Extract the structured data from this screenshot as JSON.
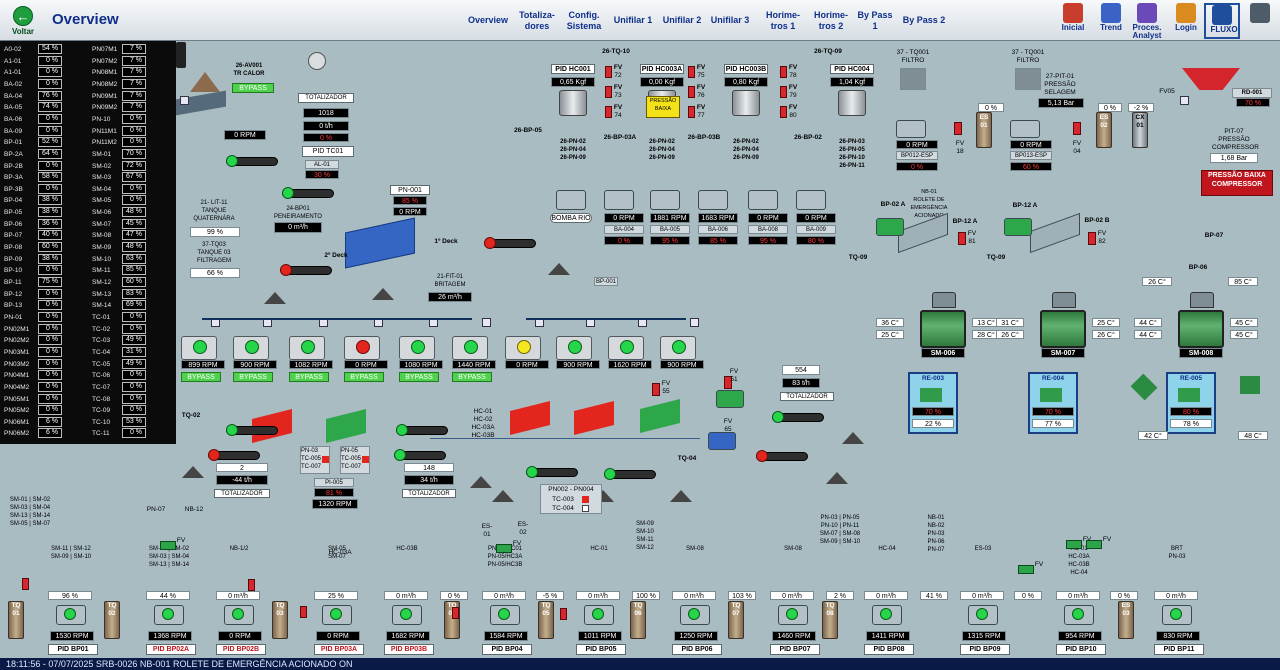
{
  "header": {
    "back_label": "Voltar",
    "title": "Overview",
    "nav": [
      "Overview",
      "Totaliza-\ndores",
      "Config.\nSistema",
      "Unifilar 1",
      "Unifilar 2",
      "Unifilar 3",
      "Horime-\ntros 1",
      "Horime-\ntros 2",
      "By Pass 1",
      "By Pass 2"
    ],
    "tools": [
      "Inicial",
      "Trend",
      "Proces.\nAnalyst",
      "Login",
      "FLUXO",
      ""
    ]
  },
  "left_table": {
    "left": [
      [
        "A0-02",
        "54 %"
      ],
      [
        "A1-01",
        "0 %"
      ],
      [
        "A1-01",
        "0 %"
      ],
      [
        "BA-02",
        "0 %"
      ],
      [
        "BA-04",
        "76 %"
      ],
      [
        "BA-05",
        "74 %"
      ],
      [
        "BA-06",
        "0 %"
      ],
      [
        "BA-09",
        "0 %"
      ],
      [
        "BP-01",
        "52 %"
      ],
      [
        "BP-2A",
        "64 %"
      ],
      [
        "BP-2B",
        "0 %"
      ],
      [
        "BP-3A",
        "58 %"
      ],
      [
        "BP-3B",
        "0 %"
      ],
      [
        "BP-04",
        "38 %"
      ],
      [
        "BP-05",
        "38 %"
      ],
      [
        "BP-06",
        "36 %"
      ],
      [
        "BP-07",
        "40 %"
      ],
      [
        "BP-08",
        "60 %"
      ],
      [
        "BP-09",
        "38 %"
      ],
      [
        "BP-10",
        "0 %"
      ],
      [
        "BP-11",
        "75 %"
      ],
      [
        "BP-12",
        "0 %"
      ],
      [
        "BP-13",
        "0 %"
      ],
      [
        "PN-01",
        "0 %"
      ],
      [
        "PN02M1",
        "0 %"
      ],
      [
        "PN02M2",
        "0 %"
      ],
      [
        "PN03M1",
        "0 %"
      ],
      [
        "PN03M2",
        "0 %"
      ],
      [
        "PN04M1",
        "0 %"
      ],
      [
        "PN04M2",
        "0 %"
      ],
      [
        "PN05M1",
        "0 %"
      ],
      [
        "PN05M2",
        "0 %"
      ],
      [
        "PN06M1",
        "6 %"
      ],
      [
        "PN06M2",
        "6 %"
      ]
    ],
    "right": [
      [
        "PN07M1",
        "7 %"
      ],
      [
        "PN07M2",
        "7 %"
      ],
      [
        "PN08M1",
        "7 %"
      ],
      [
        "PN08M2",
        "7 %"
      ],
      [
        "PN09M1",
        "7 %"
      ],
      [
        "PN09M2",
        "7 %"
      ],
      [
        "PN-10",
        "0 %"
      ],
      [
        "PN11M1",
        "0 %"
      ],
      [
        "PN11M2",
        "0 %"
      ],
      [
        "SM-01",
        "70 %"
      ],
      [
        "SM-02",
        "72 %"
      ],
      [
        "SM-03",
        "67 %"
      ],
      [
        "SM-04",
        "0 %"
      ],
      [
        "SM-05",
        "0 %"
      ],
      [
        "SM-06",
        "48 %"
      ],
      [
        "SM-07",
        "45 %"
      ],
      [
        "SM-08",
        "47 %"
      ],
      [
        "SM-09",
        "48 %"
      ],
      [
        "SM-10",
        "63 %"
      ],
      [
        "SM-11",
        "85 %"
      ],
      [
        "SM-12",
        "60 %"
      ],
      [
        "SM-13",
        "83 %"
      ],
      [
        "SM-14",
        "69 %"
      ],
      [
        "TC-01",
        "0 %"
      ],
      [
        "TC-02",
        "0 %"
      ],
      [
        "TC-03",
        "49 %"
      ],
      [
        "TC-04",
        "31 %"
      ],
      [
        "TC-05",
        "49 %"
      ],
      [
        "TC-06",
        "0 %"
      ],
      [
        "TC-07",
        "0 %"
      ],
      [
        "TC-08",
        "0 %"
      ],
      [
        "TC-09",
        "0 %"
      ],
      [
        "TC-10",
        "53 %"
      ],
      [
        "TC-11",
        "0 %"
      ]
    ]
  },
  "top_area": {
    "av001_label": "26-AV001\nTR CALOR",
    "bypass": "BYPASS",
    "rpm_av": "0 RPM",
    "totalizador_label": "TOTALIZADOR",
    "totalizador_val1": "1018",
    "totalizador_val2": "0 t/h",
    "totalizador_pct": "0 %",
    "pid_tc01": "PID TC01",
    "al01_label": "AL-01",
    "al01_pct": "30 %",
    "bp01_label": "24-BP01\nPENEIRAMENTO",
    "bp01_val": "0 m³/h",
    "pn001_label": "PN-001",
    "pn001_pct": "85 %",
    "pn001_rpm": "0 RPM",
    "deck1": "1º Deck",
    "deck2": "2º Deck",
    "lit11_label": "21- LIT-11\nTANQUE\nQUATERNÁRA",
    "lit11_val": "99 %",
    "tq03_label": "37-TQ03\nTANQUE 03\nFILTRAGEM",
    "tq03_val": "66 %",
    "fit01_label": "21-FIT-01\nBRITAGEM",
    "fit01_val": "26 m³/h",
    "bp001": "BP-001"
  },
  "hc_area": {
    "tq10": "26-TQ-10",
    "tq09": "26-TQ-09",
    "bp05": "26-BP-05",
    "bp03a": "26-BP-03A",
    "bp03b": "26-BP-03B",
    "bp02": "26-BP-02",
    "pressao": "PRESSÃO\nBAIXA",
    "units": [
      {
        "pid": "PID HC001",
        "val": "0,65 Kgf",
        "pns": "26-PN-02\n26-PN-04\n26-PN-09"
      },
      {
        "pid": "PID HC003A",
        "val": "0,00 Kgf",
        "pns": "26-PN-02\n26-PN-04\n26-PN-09"
      },
      {
        "pid": "PID HC003B",
        "val": "0,80 Kgf",
        "pns": "26-PN-02\n26-PN-04\n26-PN-09"
      },
      {
        "pid": "PID HC004",
        "val": "1,04 Kgf",
        "pns": "26-PN-03\n26-PN-05\n26-PN-10\n26-PN-11"
      }
    ],
    "fv_numbers": [
      "72",
      "73",
      "74",
      "75",
      "76",
      "77",
      "78",
      "79",
      "80"
    ],
    "fv": "FV"
  },
  "pumps": {
    "bomba_rio": "BOMBA RIO",
    "items": [
      {
        "rpm": "0 RPM",
        "name": "BA-004",
        "pct": "0 %"
      },
      {
        "rpm": "1881 RPM",
        "name": "BA-005",
        "pct": "95 %"
      },
      {
        "rpm": "1683 RPM",
        "name": "BA-006",
        "pct": "85 %"
      },
      {
        "rpm": "0 RPM",
        "name": "BA-008",
        "pct": "95 %"
      },
      {
        "rpm": "0 RPM",
        "name": "BA-009",
        "pct": "80 %"
      }
    ]
  },
  "filters": {
    "tq001a": "37 - TQ001\nFILTRO",
    "tq001b": "37 - TQ001\nFILTRO",
    "bp12": "BP012-ESP",
    "bp13": "BP013-ESP",
    "rpm12": "0 RPM",
    "rpm13": "0 RPM",
    "pct12": "0 %",
    "pct13": "60 %",
    "fv18": "FV\n18",
    "fv04": "FV\n04",
    "es01": "ES\n01",
    "es02": "ES\n02",
    "cx01": "CX\n01",
    "v1": "0 %",
    "v2": "0 %",
    "v3": "-2 %",
    "pit01_label": "27-PIT-01\nPRESSÃO\nSELAGEM",
    "pit01_val": "5,13 Bar",
    "fv05": "FV05",
    "rd001": "RD-001",
    "rd001_pct": "70 %",
    "pit07_label": "PIT-07\nPRESSÃO\nCOMPRESSOR",
    "pit07_val": "1,68 Bar",
    "alarm": "PRESSÃO BAIXA\nCOMPRESSOR"
  },
  "roller": {
    "nb01": "NB-01\nROLETE DE\nEMERGÊNCIA\nACIONADO",
    "bp02a": "BP-02 A",
    "bp12a": "BP-12 A",
    "bp12a2": "BP-12 A",
    "bp02b": "BP-02 B",
    "fv81": "FV\n81",
    "fv82": "FV\n82",
    "tq09a": "TQ-09",
    "tq09b": "TQ-09",
    "bp07": "BP-07",
    "bp06": "BP-06",
    "t26": "26 C°",
    "t85": "85 C°"
  },
  "sm_units": [
    {
      "name": "SM-006",
      "re": "RE-003",
      "re_pct": "70 %",
      "re_val": "22 %",
      "tl1": "36 C°",
      "tl2": "25 C°",
      "tr1": "13 C°",
      "tr2": "28 C°"
    },
    {
      "name": "SM-007",
      "re": "RE-004",
      "re_pct": "70 %",
      "re_val": "77 %",
      "tl1": "31 C°",
      "tl2": "26 C°",
      "tr1": "25 C°",
      "tr2": "26 C°"
    },
    {
      "name": "SM-008",
      "re": "RE-005",
      "re_pct": "80 %",
      "re_val": "78 %",
      "tl1": "44 C°",
      "tl2": "44 C°",
      "tr1": "45 C°",
      "tr2": "45 C°"
    }
  ],
  "temp_extra": {
    "t42": "42 C°",
    "t48": "48 C°"
  },
  "crushers": {
    "rpms": [
      "899 RPM",
      "900 RPM",
      "1082 RPM",
      "0 RPM",
      "1080 RPM",
      "1440 RPM",
      "0 RPM",
      "900 RPM",
      "1620 RPM",
      "900 RPM"
    ],
    "bypass": "BYPASS",
    "tq02": "TQ-02",
    "tq04": "TQ-04",
    "hc_list": "HC-01\nHC-02\nHC-03A\nHC-03B",
    "v554": "554",
    "v83": "83 t/h",
    "totalizador": "TOTALIZADOR",
    "fv51": "FV\n51",
    "fv55": "FV\n55",
    "fv65": "FV\n65"
  },
  "lower_mid": {
    "t2": "2",
    "t44": "-44 t/h",
    "totalizador": "TOTALIZADOR",
    "pn03": "PN-03\nTC-005\nTC-007",
    "pn05": "PN-05\nTC-005\nTC-007",
    "pi005": "PI-005",
    "pi005_pct": "81 %",
    "pi005_rpm": "1320 RPM",
    "t148": "148",
    "t34": "34 t/h",
    "totalizador2": "TOTALIZADOR",
    "pn002": "PN002 - PN004",
    "tc003": "TC-003",
    "tc004": "TC-004"
  },
  "bottom": {
    "units": [
      {
        "flow": "96 %",
        "rpm": "1530 RPM",
        "pid": "PID BP01",
        "pid_red": false,
        "tag": "SM-11 | SM-12\nSM-09 | SM-10"
      },
      {
        "flow": "44 %",
        "rpm": "1368 RPM",
        "pid": "PID BP02A",
        "pid_red": true,
        "tag": "SM-01 | SM-02\nSM-03 | SM-04\nSM-13 | SM-14"
      },
      {
        "flow": "0 m³/h",
        "rpm": "0 RPM",
        "pid": "PID BP02B",
        "pid_red": true,
        "tag": "NB-1/2"
      },
      {
        "flow": "25 %",
        "rpm": "0 RPM",
        "pid": "PID BP03A",
        "pid_red": true,
        "tag": "SM-05\nSM-07"
      },
      {
        "flow": "0 m³/h",
        "rpm": "1682 RPM",
        "pid": "PID BP03B",
        "pid_red": true,
        "tag": "HC-03B"
      },
      {
        "flow": "0 m³/h",
        "rpm": "1584 RPM",
        "pid": "PID BP04",
        "pid_red": false,
        "tag": "PN-05/NC01\nPN-05/HC3A\nPN-05/HC3B"
      },
      {
        "flow": "0 m³/h",
        "rpm": "1011 RPM",
        "pid": "PID BP05",
        "pid_red": false,
        "tag": "HC-01"
      },
      {
        "flow": "0 m³/h",
        "rpm": "1250 RPM",
        "pid": "PID BP06",
        "pid_red": false,
        "tag": "SM-08"
      },
      {
        "flow": "0 m³/h",
        "rpm": "1460 RPM",
        "pid": "PID BP07",
        "pid_red": false,
        "tag": "SM-08"
      },
      {
        "flow": "0 m³/h",
        "rpm": "1411 RPM",
        "pid": "PID BP08",
        "pid_red": false,
        "tag": "HC-04"
      },
      {
        "flow": "0 m³/h",
        "rpm": "1315 RPM",
        "pid": "PID BP09",
        "pid_red": false,
        "tag": "ES-03"
      },
      {
        "flow": "0 m³/h",
        "rpm": "954 RPM",
        "pid": "PID BP10",
        "pid_red": false,
        "tag": "HC-01\nHC-03A\nHC-03B\nHC-04"
      },
      {
        "flow": "0 m³/h",
        "rpm": "830 RPM",
        "pid": "PID BP11",
        "pid_red": false,
        "tag": "BRT\nPN-03"
      }
    ],
    "tanks": [
      "TQ\n01",
      "TQ\n02",
      "TQ\n03",
      "TQ\n04",
      "TQ\n05",
      "TQ\n06",
      "TQ\n07",
      "TQ\n08",
      "ES\n03"
    ],
    "extra_vals": [
      "0 %",
      "-5 %",
      "100 %",
      "103 %",
      "2 %",
      "41 %",
      "0 %",
      "0 %"
    ],
    "labels": {
      "sm0104": "SM-01 | SM-02\nSM-03 | SM-04\nSM-13 | SM-14\nSM-05 | SM-07",
      "pn07": "PN-07",
      "nb12": "NB-12",
      "hc03a": "HC-03A",
      "sm0910": "SM-09\nSM-10\nSM-11\nSM-12",
      "pn0309": "PN-03 | PN-05\nPN-10 | PN-11\nSM-07 | SM-08\nSM-09 | SM-10",
      "nb0107": "NB-01\nNB-02\nPN-03\nPN-06\nPN-07",
      "es01": "ES-01",
      "es02": "ES-02",
      "fv": "FV"
    }
  },
  "status": {
    "text": "18:11:56 - 07/07/2025   SRB-0026 NB-001 ROLETE DE EMERGÊNCIA ACIONADO         ON"
  }
}
